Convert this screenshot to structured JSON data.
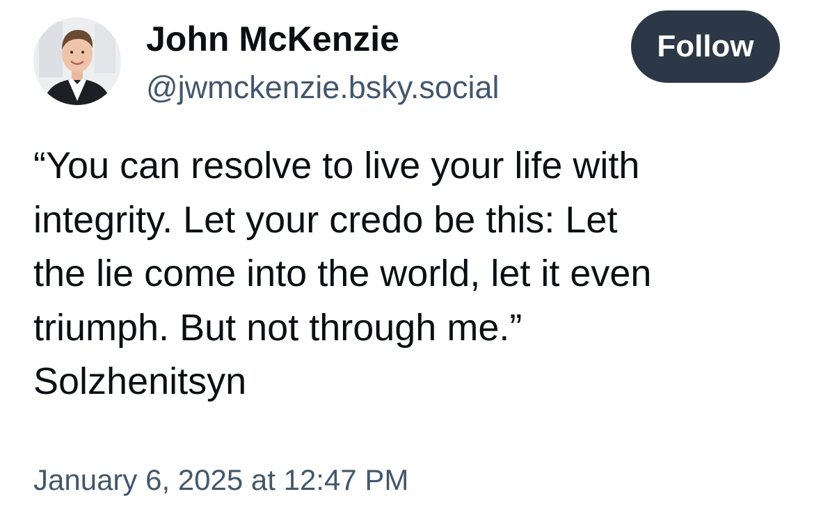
{
  "author": {
    "display_name": "John McKenzie",
    "handle": "@jwmckenzie.bsky.social"
  },
  "actions": {
    "follow_label": "Follow"
  },
  "post": {
    "lines": [
      "“You can resolve to live your life with",
      "integrity. Let your credo be this: Let",
      "the lie come into the world, let it even",
      "triumph. But not through me.”",
      "Solzhenitsyn"
    ],
    "timestamp": "January 6, 2025 at 12:47 PM"
  },
  "colors": {
    "follow_button_bg": "#2c3847",
    "secondary_text": "#42576c",
    "primary_text": "#0b0f14"
  }
}
